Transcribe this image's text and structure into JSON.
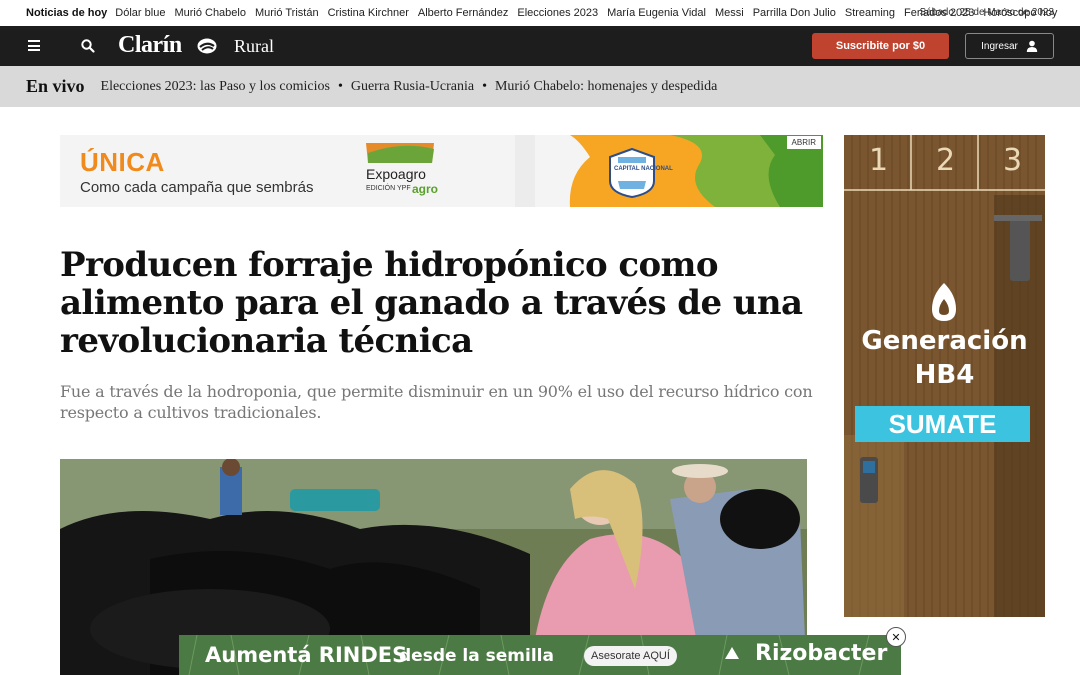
{
  "trending": {
    "label": "Noticias de hoy",
    "items": [
      "Dólar blue",
      "Murió Chabelo",
      "Murió Tristán",
      "Cristina Kirchner",
      "Alberto Fernández",
      "Elecciones 2023",
      "María Eugenia Vidal",
      "Messi",
      "Parrilla Don Julio",
      "Streaming",
      "Feriados 2023",
      "Horóscopo hoy"
    ],
    "date": "Sábado, 25 de Marzo de 2023"
  },
  "header": {
    "logo": "Clarín",
    "section": "Rural",
    "subscribe": "Suscribite por $0",
    "login": "Ingresar"
  },
  "live": {
    "label": "En vivo",
    "items": [
      "Elecciones 2023: las Paso y los comicios",
      "Guerra Rusia-Ucrania",
      "Murió Chabelo: homenajes y despedida"
    ],
    "separator": "•"
  },
  "top_ad": {
    "brand": "ÚNICA",
    "slogan": "Como cada campaña que sembrás",
    "event": "Expoagro",
    "edition": "EDICIÓN YPF",
    "edition_brand": "agro",
    "badge": "CAPITAL NACIONAL",
    "open": "ABRIR"
  },
  "side_ad": {
    "steps": [
      "1",
      "2",
      "3"
    ],
    "line1": "Generación",
    "line2": "HB4",
    "cta": "SUMATE"
  },
  "article": {
    "title": "Producen forraje hidropónico como alimento para el ganado a través de una revolucionaria técnica",
    "subtitle": "Fue a través de la hodroponia, que permite disminuir en un 90% el uso del recurso hídrico con respecto a cultivos tradicionales."
  },
  "bottom_ad": {
    "text1": "Aumentá RINDES",
    "text2": "desde la semilla",
    "cta": "Asesorate AQUÍ",
    "brand": "Rizobacter",
    "close": "✕"
  },
  "colors": {
    "header_bg": "#1d1d1d",
    "subscribe_bg": "#c0432f",
    "live_bg": "#d9d9d9",
    "accent_orange": "#f08a1c",
    "sumate_bg": "#3cc3e0"
  }
}
